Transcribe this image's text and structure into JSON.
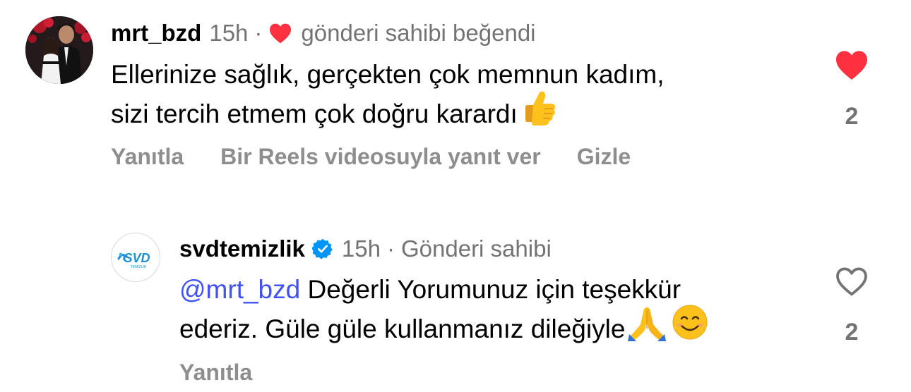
{
  "comments": [
    {
      "username": "mrt_bzd",
      "time": "15h",
      "separator": "·",
      "liked_by_author_text": "gönderi sahibi beğendi",
      "text_line1": "Ellerinize sağlık, gerçekten çok memnun kadım,",
      "text_line2": "sizi tercih etmem çok doğru karardı",
      "emoji": "thumbs-up",
      "actions": {
        "reply": "Yanıtla",
        "reels_reply": "Bir Reels videosuyla yanıt ver",
        "hide": "Gizle"
      },
      "liked": true,
      "like_count": "2"
    },
    {
      "username": "svdtemizlik",
      "verified": true,
      "time": "15h",
      "separator": "·",
      "author_badge": "Gönderi sahibi",
      "mention": "@mrt_bzd",
      "text_line1_rest": "Değerli Yorumunuz için teşekkür",
      "text_line2": "ederiz. Güle güle kullanmanız dileğiyle",
      "emojis": [
        "folded-hands",
        "smiling-face"
      ],
      "avatar_logo_text": "SVD",
      "avatar_logo_subtext": "TEMİZLİK",
      "actions": {
        "reply": "Yanıtla"
      },
      "liked": false,
      "like_count": "2"
    }
  ],
  "colors": {
    "like_red": "#ff3040",
    "mention_blue": "#4150f7",
    "verified_blue": "#0095f6",
    "secondary_text": "#737373",
    "action_text": "#8e8e8e"
  }
}
